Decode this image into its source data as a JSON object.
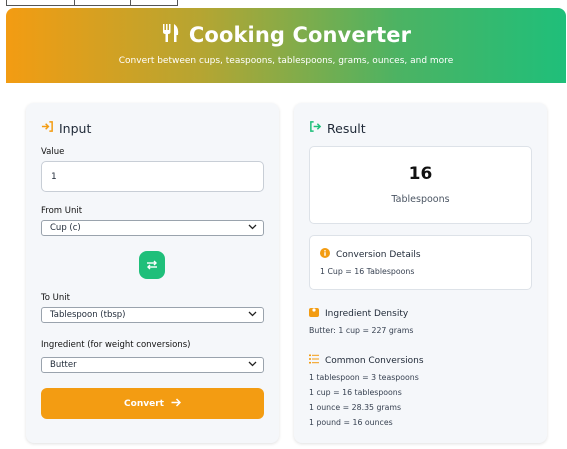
{
  "header": {
    "title": "Cooking Converter",
    "subtitle": "Convert between cups, teaspoons, tablespoons, grams, ounces, and more",
    "icon": "utensils-icon"
  },
  "input_panel": {
    "heading": "Input",
    "value_label": "Value",
    "value": "1",
    "from_label": "From Unit",
    "from_value": "Cup (c)",
    "to_label": "To Unit",
    "to_value": "Tablespoon (tbsp)",
    "ingredient_label": "Ingredient (for weight conversions)",
    "ingredient_value": "Butter",
    "convert_label": "Convert"
  },
  "result_panel": {
    "heading": "Result",
    "value": "16",
    "unit": "Tablespoons",
    "details_title": "Conversion Details",
    "details_text": "1 Cup = 16 Tablespoons",
    "density_title": "Ingredient Density",
    "density_text": "Butter: 1 cup = 227 grams",
    "common_title": "Common Conversions",
    "common": [
      "1 tablespoon = 3 teaspoons",
      "1 cup = 16 tablespoons",
      "1 ounce = 28.35 grams",
      "1 pound = 16 ounces"
    ]
  },
  "colors": {
    "orange": "#f39c12",
    "green": "#1fbf7a"
  }
}
